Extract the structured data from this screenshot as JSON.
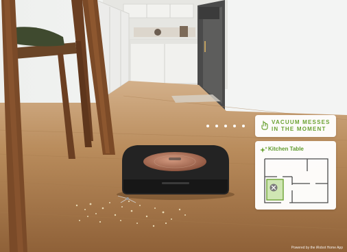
{
  "colors": {
    "accent_green": "#6ba233",
    "floor": "#b68955",
    "robot_copper": "#b4765e"
  },
  "callout": {
    "icon": "vacuum-hand-icon",
    "line1": "VACUUM MESSES",
    "line2": "IN THE MOMENT"
  },
  "map_card": {
    "icon": "sparkle-icon",
    "title": "Kitchen Table",
    "marker_icon": "x-marker-icon"
  },
  "footer": {
    "credit": "Powered by the iRobot Home App"
  }
}
